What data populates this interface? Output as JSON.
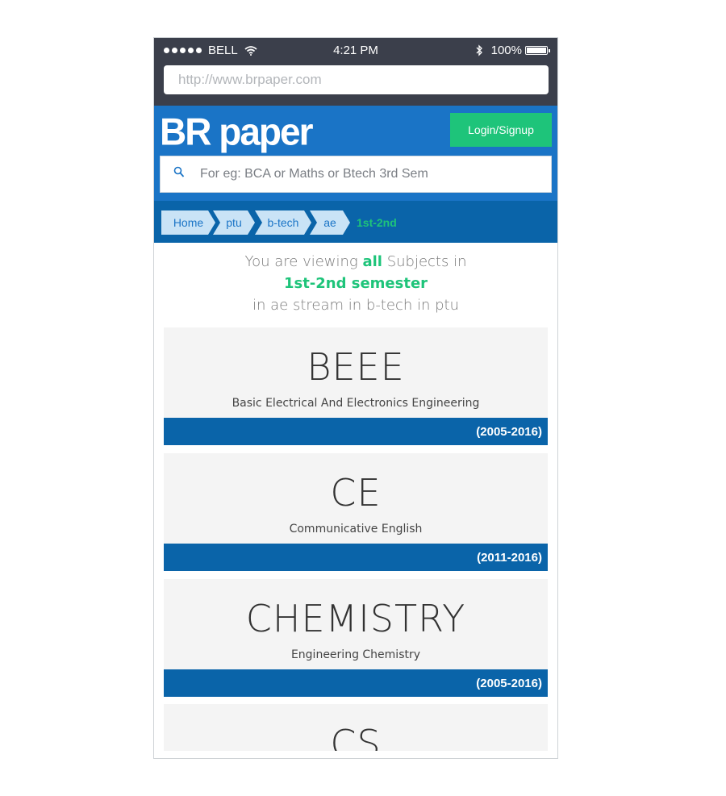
{
  "status_bar": {
    "carrier": "BELL",
    "time": "4:21 PM",
    "battery": "100%",
    "battery_level": 1.0
  },
  "browser": {
    "url": "http://www.brpaper.com"
  },
  "header": {
    "logo": "BR paper",
    "login_label": "Login/Signup",
    "search_placeholder": "For eg: BCA or Maths or Btech 3rd Sem"
  },
  "breadcrumb": {
    "items": [
      "Home",
      "ptu",
      "b-tech",
      "ae"
    ],
    "current": "1st-2nd"
  },
  "viewing": {
    "prefix": "You are viewing ",
    "highlight": "all",
    "suffix": " Subjects in",
    "semester": "1st-2nd semester",
    "detail": "in ae stream in b-tech in ptu"
  },
  "subjects": [
    {
      "code": "BEEE",
      "name": "Basic Electrical And Electronics Engineering",
      "years": "(2005-2016)"
    },
    {
      "code": "CE",
      "name": "Communicative English",
      "years": "(2011-2016)"
    },
    {
      "code": "CHEMISTRY",
      "name": "Engineering Chemistry",
      "years": "(2005-2016)"
    },
    {
      "code": "CS",
      "name": "",
      "years": ""
    }
  ],
  "colors": {
    "header_blue": "#1a74c6",
    "dark_blue": "#0a64a9",
    "green": "#1ec47a",
    "chrome_gray": "#3b3f4b"
  }
}
